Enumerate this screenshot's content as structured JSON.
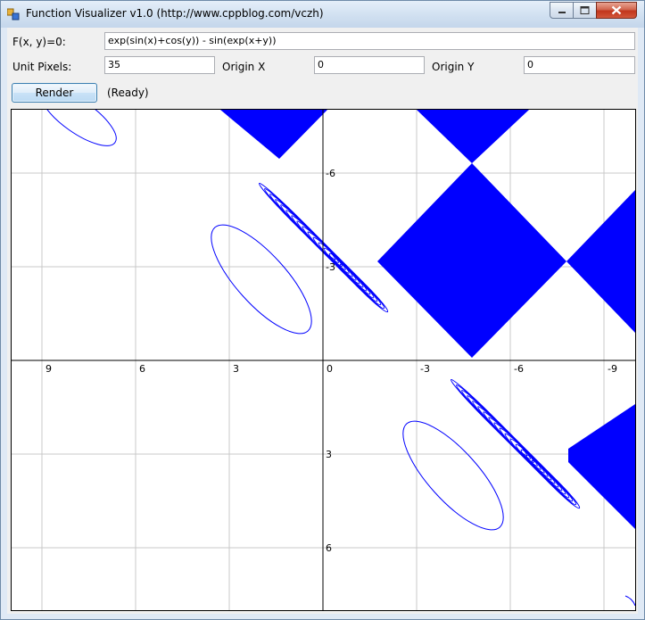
{
  "window": {
    "title": "Function Visualizer v1.0 (http://www.cppblog.com/vczh)"
  },
  "form": {
    "function_label": "F(x, y)=0:",
    "function_value": "exp(sin(x)+cos(y)) - sin(exp(x+y))",
    "unit_label": "Unit Pixels:",
    "unit_value": "35",
    "origin_x_label": "Origin X",
    "origin_x_value": "0",
    "origin_y_label": "Origin Y",
    "origin_y_value": "0",
    "render_label": "Render",
    "status": "(Ready)"
  },
  "plot": {
    "curve_color": "#0000ff",
    "grid_color": "#c8c8c8",
    "x_ticks": [
      "9",
      "6",
      "3",
      "0",
      "-3",
      "-6",
      "-9"
    ],
    "y_ticks": [
      "-6",
      "-3",
      "3",
      "6"
    ]
  }
}
